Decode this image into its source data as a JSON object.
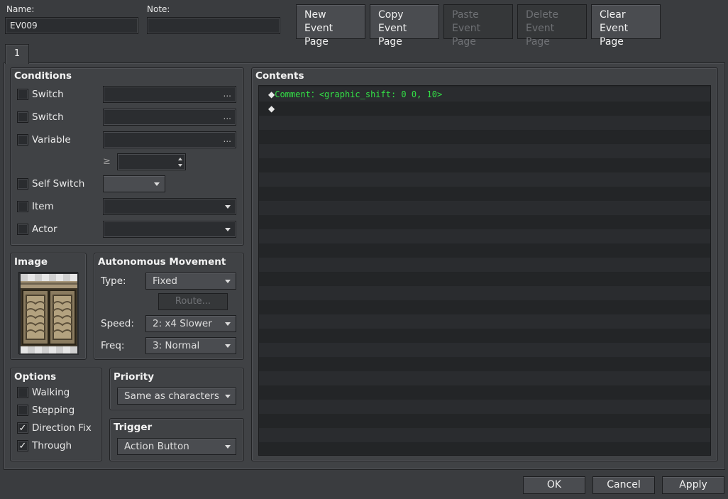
{
  "header": {
    "name_label": "Name:",
    "name_value": "EV009",
    "note_label": "Note:",
    "note_value": "",
    "buttons": [
      {
        "line1": "New",
        "line2": "Event Page",
        "enabled": true
      },
      {
        "line1": "Copy",
        "line2": "Event Page",
        "enabled": true
      },
      {
        "line1": "Paste",
        "line2": "Event Page",
        "enabled": false
      },
      {
        "line1": "Delete",
        "line2": "Event Page",
        "enabled": false
      },
      {
        "line1": "Clear",
        "line2": "Event Page",
        "enabled": true
      }
    ]
  },
  "tabs": [
    {
      "label": "1"
    }
  ],
  "conditions": {
    "title": "Conditions",
    "switch1_label": "Switch",
    "switch2_label": "Switch",
    "variable_label": "Variable",
    "ge_symbol": "≥",
    "self_switch_label": "Self Switch",
    "item_label": "Item",
    "actor_label": "Actor",
    "picker_ellipsis": "..."
  },
  "image": {
    "title": "Image"
  },
  "autonomous": {
    "title": "Autonomous Movement",
    "type_label": "Type:",
    "type_value": "Fixed",
    "route_label": "Route...",
    "speed_label": "Speed:",
    "speed_value": "2: x4 Slower",
    "freq_label": "Freq:",
    "freq_value": "3: Normal"
  },
  "options": {
    "title": "Options",
    "walking": "Walking",
    "stepping": "Stepping",
    "direction_fix": "Direction Fix",
    "through": "Through",
    "check_mark": "✓"
  },
  "priority": {
    "title": "Priority",
    "value": "Same as characters"
  },
  "trigger": {
    "title": "Trigger",
    "value": "Action Button"
  },
  "contents": {
    "title": "Contents",
    "line1_marker": "◆",
    "line1_command": "Comment",
    "line1_sep": "：",
    "line1_text": "<graphic_shift: 0 0, 10>",
    "line2_marker": "◆"
  },
  "footer": {
    "ok": "OK",
    "cancel": "Cancel",
    "apply": "Apply"
  },
  "colors": {
    "comment_green": "#33e046",
    "panel": "#404245",
    "background": "#3a3c3f"
  }
}
